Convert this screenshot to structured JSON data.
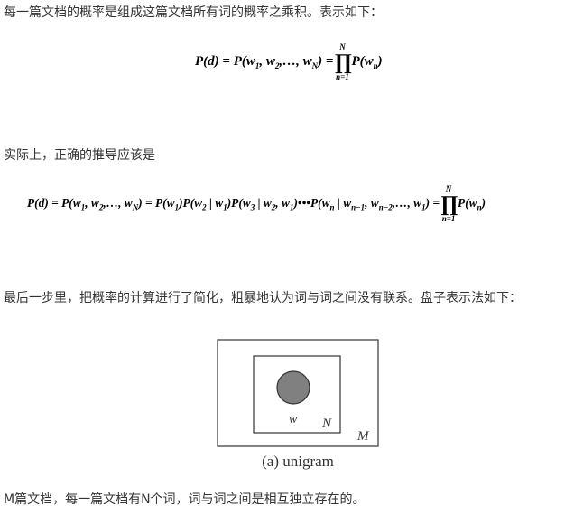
{
  "paragraphs": {
    "intro": "每一篇文档的概率是组成这篇文档所有词的概率之乘积。表示如下：",
    "actual": "实际上，正确的推导应该是",
    "simplify": "最后一步里，把概率的计算进行了简化，粗暴地认为词与词之间没有联系。盘子表示法如下：",
    "summary": "M篇文档，每一篇文档有N个词，词与词之间是相互独立存在的。"
  },
  "formula1": {
    "lhs": "P(d)",
    "mid": "P(w₁,w₂,…,w_N)",
    "prod_top": "N",
    "prod_bottom": "n=1",
    "rhs": "P(w_n)"
  },
  "formula2": {
    "lhs": "P(d)",
    "term1": "P(w₁,w₂,…,w_N)",
    "term2": "P(w₁)P(w₂ | w₁)P(w₃ | w₂,w₁)•••P(w_n | w_{n−1},w_{n−2},…,w₁)",
    "prod_top": "N",
    "prod_bottom": "n=1",
    "rhs": "P(w_n)"
  },
  "plate": {
    "inner_label": "N",
    "outer_label": "M",
    "node_label": "w",
    "caption": "(a) unigram"
  }
}
